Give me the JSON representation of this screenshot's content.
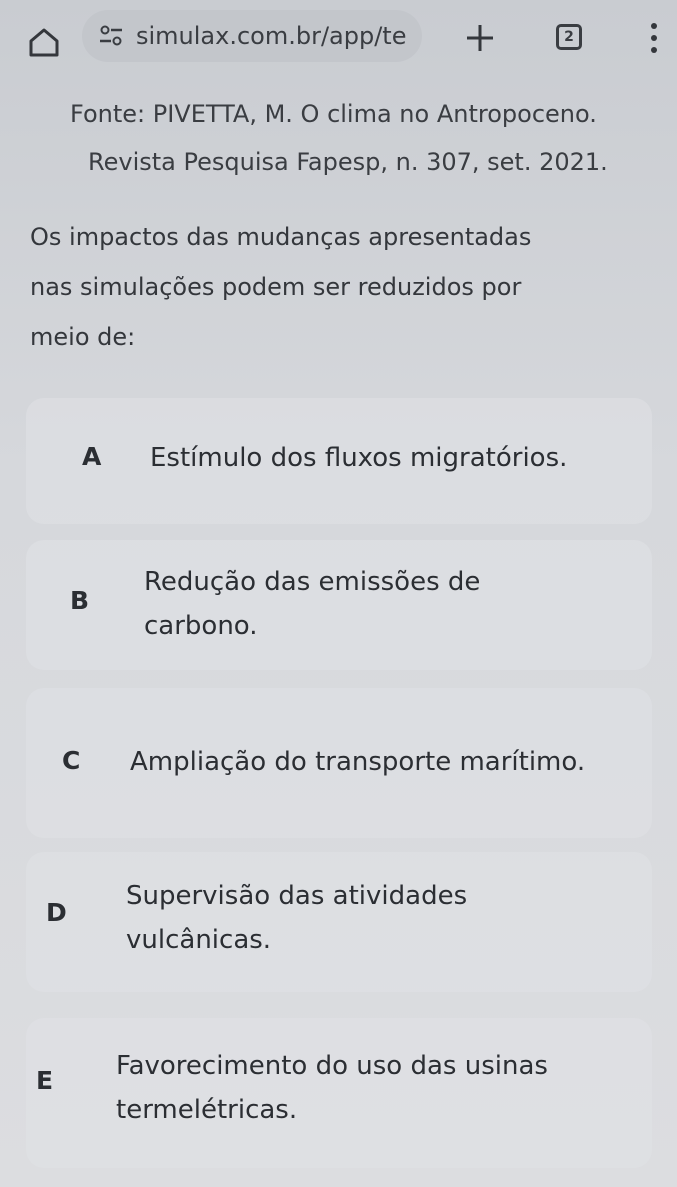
{
  "browser": {
    "url": "simulax.com.br/app/te",
    "tab_count": "2",
    "home_icon": "home-icon",
    "site_info_icon": "tune-icon",
    "new_tab_icon": "plus-icon",
    "menu_icon": "vertical-dots-icon"
  },
  "question": {
    "source_line1": "Fonte: PIVETTA, M. O clima no Antropoceno.",
    "source_line2": "Revista Pesquisa Fapesp, n. 307, set. 2021.",
    "stem_line1": "Os impactos das mudanças apresentadas",
    "stem_line2": "nas simulações podem ser reduzidos por",
    "stem_line3": "meio de:"
  },
  "options": [
    {
      "letter": "A",
      "line1": "Estímulo dos fluxos migratórios.",
      "line2": ""
    },
    {
      "letter": "B",
      "line1": "Redução das emissões de",
      "line2": "carbono."
    },
    {
      "letter": "C",
      "line1": "Ampliação do transporte marítimo.",
      "line2": ""
    },
    {
      "letter": "D",
      "line1": "Supervisão das atividades",
      "line2": "vulcânicas."
    },
    {
      "letter": "E",
      "line1": "Favorecimento do uso das usinas",
      "line2": "termelétricas."
    }
  ]
}
